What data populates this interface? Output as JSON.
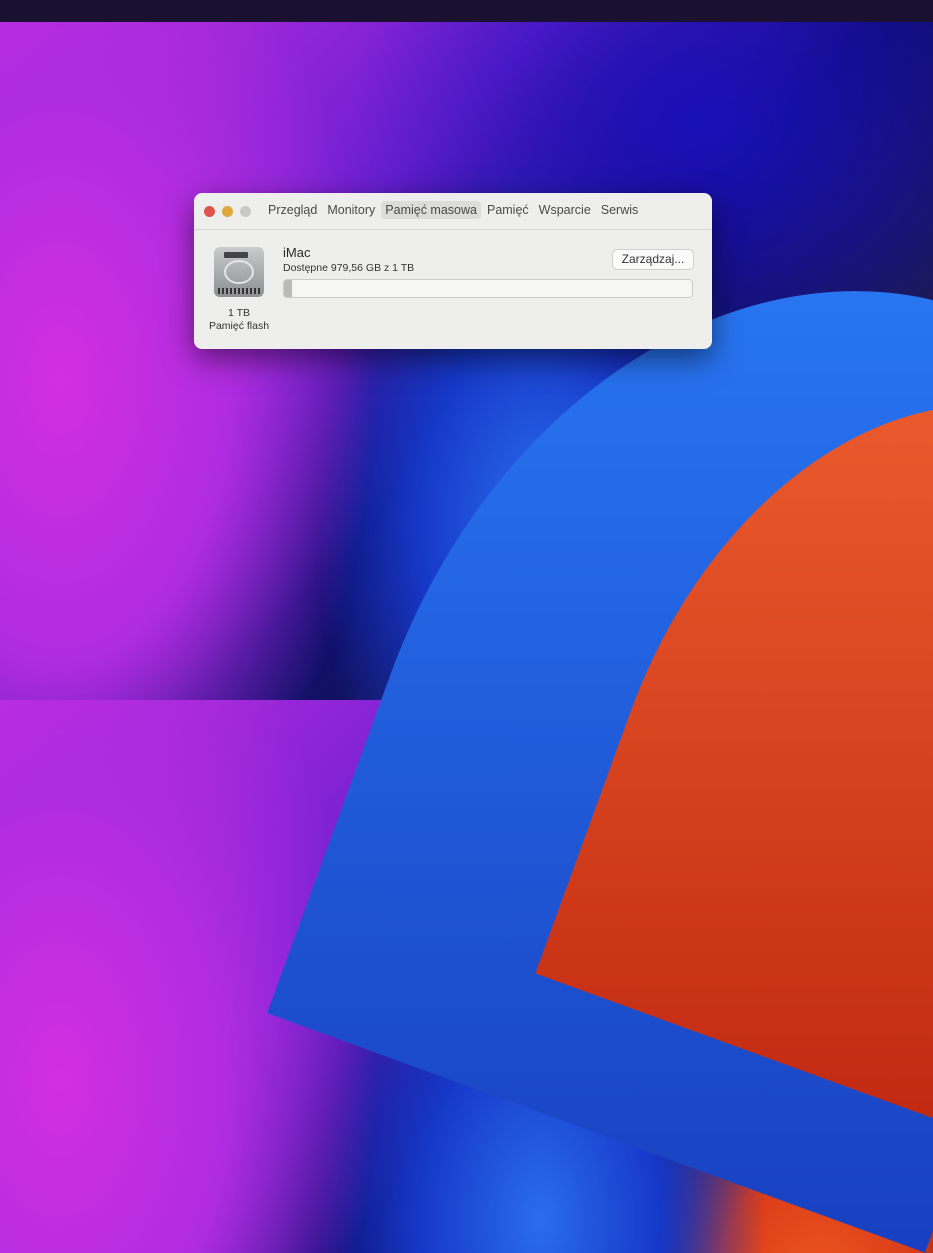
{
  "window": {
    "tabs": [
      {
        "label": "Przegląd",
        "active": false
      },
      {
        "label": "Monitory",
        "active": false
      },
      {
        "label": "Pamięć masowa",
        "active": true
      },
      {
        "label": "Pamięć",
        "active": false
      },
      {
        "label": "Wsparcie",
        "active": false
      },
      {
        "label": "Serwis",
        "active": false
      }
    ],
    "drive": {
      "capacity": "1 TB",
      "type": "Pamięć flash",
      "name": "iMac",
      "available": "Dostępne 979,56 GB z 1 TB",
      "used_fraction": 0.02
    },
    "manage_button": "Zarządzaj..."
  }
}
